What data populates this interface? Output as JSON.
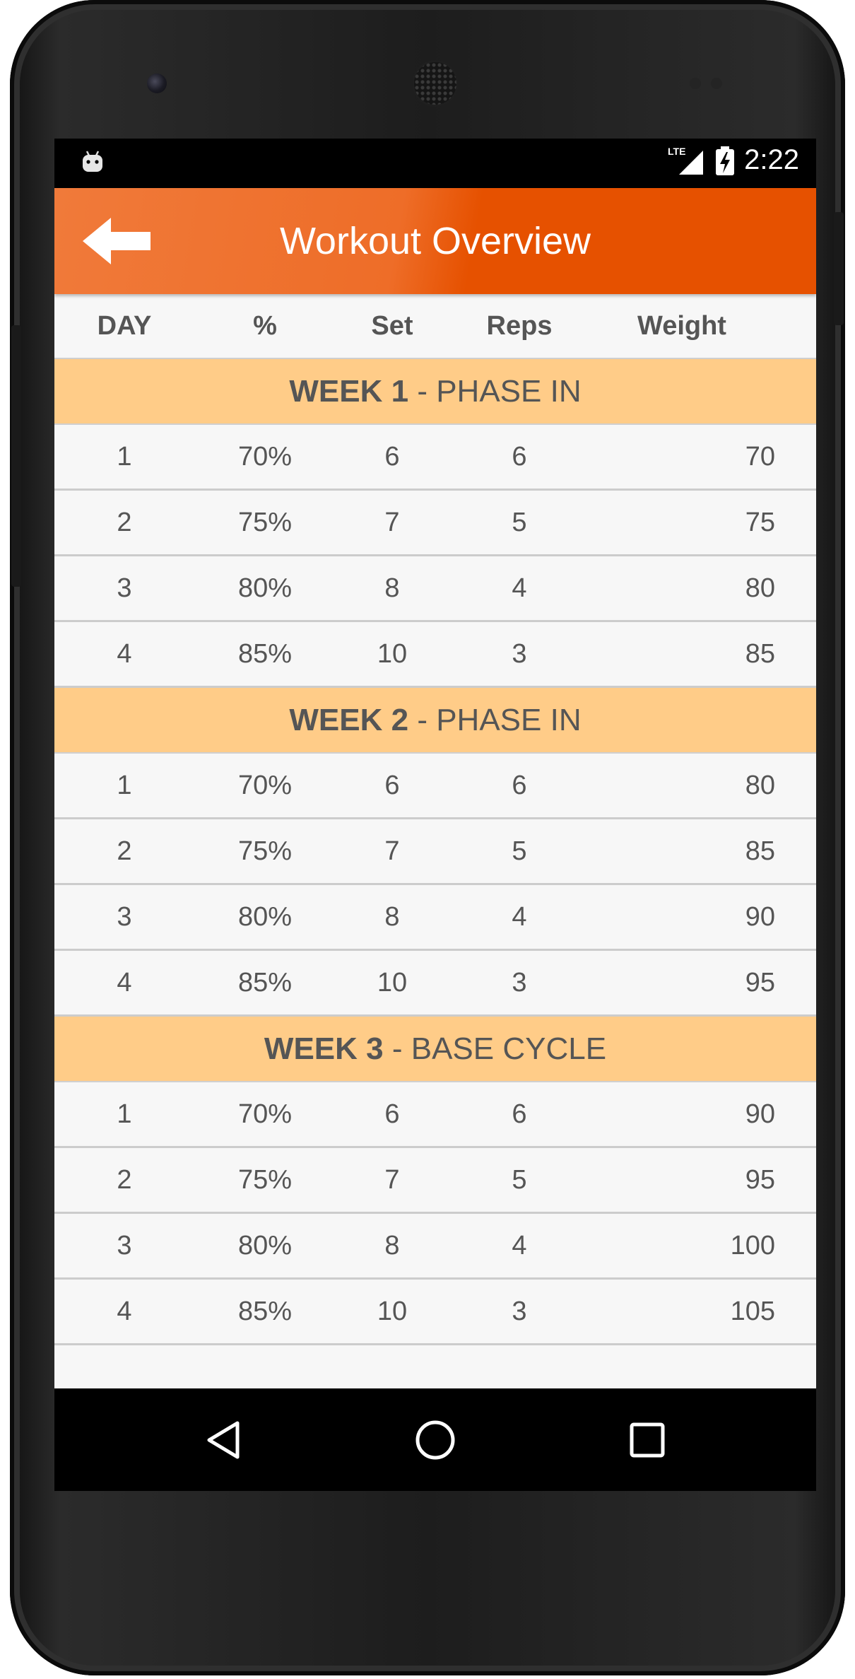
{
  "status_bar": {
    "time": "2:22",
    "network": "LTE",
    "icons": [
      "android-robot-icon",
      "signal-icon",
      "battery-charging-icon"
    ]
  },
  "app_bar": {
    "title": "Workout Overview",
    "back_icon": "arrow-left-icon"
  },
  "table": {
    "headers": [
      "DAY",
      "%",
      "Set",
      "Reps",
      "Weight"
    ],
    "weeks": [
      {
        "week": "WEEK 1",
        "separator": " - ",
        "phase": "PHASE IN",
        "rows": [
          {
            "day": "1",
            "pct": "70%",
            "set": "6",
            "reps": "6",
            "weight": "70"
          },
          {
            "day": "2",
            "pct": "75%",
            "set": "7",
            "reps": "5",
            "weight": "75"
          },
          {
            "day": "3",
            "pct": "80%",
            "set": "8",
            "reps": "4",
            "weight": "80"
          },
          {
            "day": "4",
            "pct": "85%",
            "set": "10",
            "reps": "3",
            "weight": "85"
          }
        ]
      },
      {
        "week": "WEEK 2",
        "separator": " - ",
        "phase": "PHASE IN",
        "rows": [
          {
            "day": "1",
            "pct": "70%",
            "set": "6",
            "reps": "6",
            "weight": "80"
          },
          {
            "day": "2",
            "pct": "75%",
            "set": "7",
            "reps": "5",
            "weight": "85"
          },
          {
            "day": "3",
            "pct": "80%",
            "set": "8",
            "reps": "4",
            "weight": "90"
          },
          {
            "day": "4",
            "pct": "85%",
            "set": "10",
            "reps": "3",
            "weight": "95"
          }
        ]
      },
      {
        "week": "WEEK 3",
        "separator": " - ",
        "phase": "BASE CYCLE",
        "rows": [
          {
            "day": "1",
            "pct": "70%",
            "set": "6",
            "reps": "6",
            "weight": "90"
          },
          {
            "day": "2",
            "pct": "75%",
            "set": "7",
            "reps": "5",
            "weight": "95"
          },
          {
            "day": "3",
            "pct": "80%",
            "set": "8",
            "reps": "4",
            "weight": "100"
          },
          {
            "day": "4",
            "pct": "85%",
            "set": "10",
            "reps": "3",
            "weight": "105"
          }
        ]
      }
    ]
  },
  "nav_bar": {
    "icons": [
      "back-triangle-icon",
      "home-circle-icon",
      "recents-square-icon"
    ]
  },
  "colors": {
    "app_bar": "#e65100",
    "week_header": "#ffcc88",
    "row_bg": "#f7f7f7",
    "text": "#555555"
  }
}
